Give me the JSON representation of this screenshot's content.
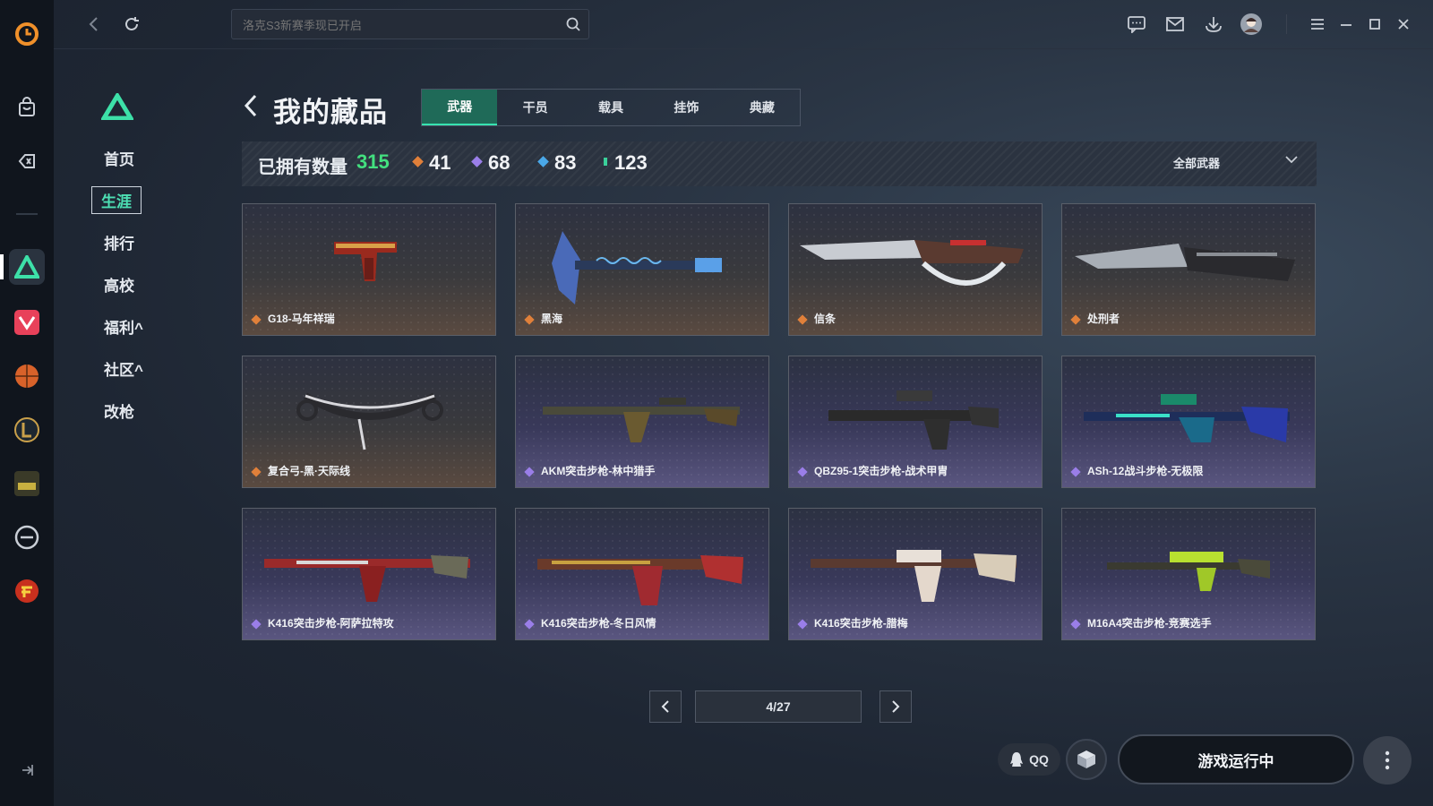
{
  "search": {
    "placeholder": "洛克S3新赛季现已开启"
  },
  "nav": {
    "items": [
      {
        "label": "首页"
      },
      {
        "label": "生涯"
      },
      {
        "label": "排行"
      },
      {
        "label": "高校"
      },
      {
        "label": "福利^"
      },
      {
        "label": "社区^"
      },
      {
        "label": "改枪"
      }
    ]
  },
  "page": {
    "title": "我的藏品"
  },
  "tabs": [
    "武器",
    "干员",
    "载具",
    "挂饰",
    "典藏"
  ],
  "stats": {
    "owned_label": "已拥有数量",
    "owned_count": "315",
    "rarities": [
      {
        "count": "41",
        "color": "#e0803a"
      },
      {
        "count": "68",
        "color": "#9a7ee8"
      },
      {
        "count": "83",
        "color": "#4aa8e8"
      },
      {
        "count": "123",
        "color": "#3ad09a"
      }
    ],
    "filter": "全部武器"
  },
  "items": [
    {
      "name": "G18-马年祥瑞",
      "rarity": "orange"
    },
    {
      "name": "黑海",
      "rarity": "orange"
    },
    {
      "name": "信条",
      "rarity": "orange"
    },
    {
      "name": "处刑者",
      "rarity": "orange"
    },
    {
      "name": "复合弓-黑·天际线",
      "rarity": "orange"
    },
    {
      "name": "AKM突击步枪-林中猎手",
      "rarity": "purple"
    },
    {
      "name": "QBZ95-1突击步枪-战术甲胄",
      "rarity": "purple"
    },
    {
      "name": "ASh-12战斗步枪-无极限",
      "rarity": "purple"
    },
    {
      "name": "K416突击步枪-阿萨拉特攻",
      "rarity": "purple"
    },
    {
      "name": "K416突击步枪-冬日风情",
      "rarity": "purple"
    },
    {
      "name": "K416突击步枪-腊梅",
      "rarity": "purple"
    },
    {
      "name": "M16A4突击步枪-竞赛选手",
      "rarity": "purple"
    }
  ],
  "pagination": {
    "indicator": "4/27"
  },
  "footer": {
    "qq_label": "QQ",
    "run_label": "游戏运行中"
  },
  "colors": {
    "accent": "#37e3b0",
    "owned": "#43e07f"
  }
}
